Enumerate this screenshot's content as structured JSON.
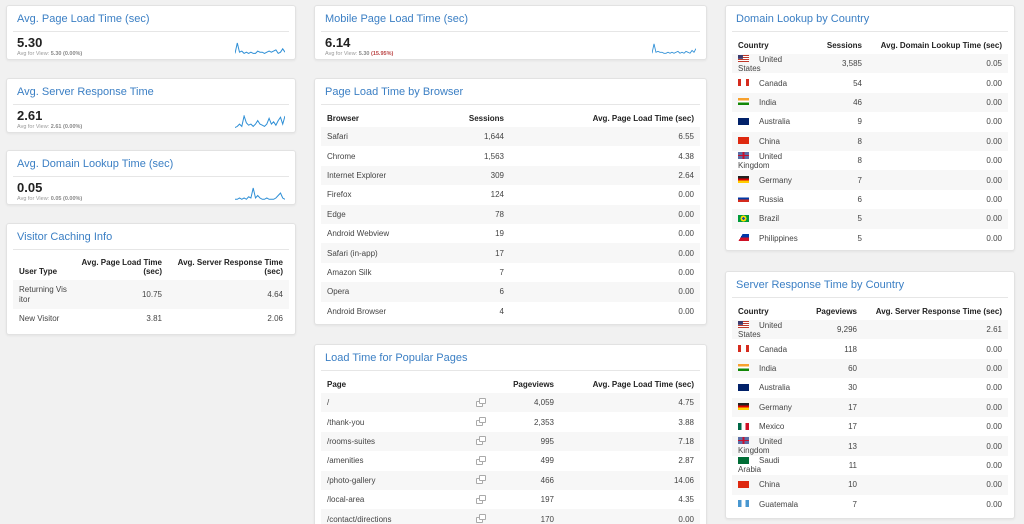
{
  "stat_cards": [
    {
      "title": "Avg. Page Load Time (sec)",
      "value": "5.30",
      "sub_label": "Avg for View:",
      "sub_value": "5.30",
      "sub_change": "(0.00%)",
      "sparkline": [
        4,
        13,
        5,
        6,
        4,
        5,
        4,
        5,
        4,
        4,
        6,
        5,
        5,
        4,
        5,
        6,
        5,
        6,
        7,
        4,
        5,
        8,
        5
      ]
    },
    {
      "title": "Avg. Server Response Time",
      "value": "2.61",
      "sub_label": "Avg for View:",
      "sub_value": "2.61",
      "sub_change": "(0.00%)",
      "sparkline": [
        3,
        4,
        6,
        4,
        13,
        7,
        5,
        6,
        4,
        6,
        9,
        6,
        5,
        4,
        6,
        11,
        6,
        8,
        5,
        9,
        12,
        6,
        13
      ]
    },
    {
      "title": "Avg. Domain Lookup Time (sec)",
      "value": "0.05",
      "sub_label": "Avg for View:",
      "sub_value": "0.05",
      "sub_change": "(0.00%)",
      "sparkline": [
        3,
        3,
        4,
        3,
        4,
        3,
        5,
        4,
        12,
        4,
        6,
        4,
        3,
        3,
        4,
        3,
        3,
        3,
        4,
        6,
        8,
        4,
        3
      ]
    },
    {
      "title": "Mobile Page Load Time (sec)",
      "value": "6.14",
      "sub_label": "Avg for View:",
      "sub_value": "5.30",
      "sub_change": "(15.95%)",
      "sparkline": [
        4,
        14,
        5,
        6,
        5,
        5,
        4,
        4,
        5,
        4,
        5,
        4,
        5,
        6,
        4,
        5,
        4,
        6,
        5,
        4,
        7,
        5,
        9
      ]
    }
  ],
  "visitor_caching": {
    "title": "Visitor Caching Info",
    "columns": [
      "User Type",
      "Avg. Page Load Time (sec)",
      "Avg. Server Response Time (sec)"
    ],
    "rows": [
      [
        "Returning Visitor",
        "10.75",
        "4.64"
      ],
      [
        "New Visitor",
        "3.81",
        "2.06"
      ]
    ]
  },
  "browser_table": {
    "title": "Page Load Time by Browser",
    "columns": [
      "Browser",
      "Sessions",
      "Avg. Page Load Time (sec)"
    ],
    "rows": [
      [
        "Safari",
        "1,644",
        "6.55"
      ],
      [
        "Chrome",
        "1,563",
        "4.38"
      ],
      [
        "Internet Explorer",
        "309",
        "2.64"
      ],
      [
        "Firefox",
        "124",
        "0.00"
      ],
      [
        "Edge",
        "78",
        "0.00"
      ],
      [
        "Android Webview",
        "19",
        "0.00"
      ],
      [
        "Safari (in-app)",
        "17",
        "0.00"
      ],
      [
        "Amazon Silk",
        "7",
        "0.00"
      ],
      [
        "Opera",
        "6",
        "0.00"
      ],
      [
        "Android Browser",
        "4",
        "0.00"
      ]
    ]
  },
  "pages_table": {
    "title": "Load Time for Popular Pages",
    "columns": [
      "Page",
      "Pageviews",
      "Avg. Page Load Time (sec)"
    ],
    "link_icon": "external-link-icon",
    "rows": [
      [
        "/",
        "4,059",
        "4.75"
      ],
      [
        "/thank-you",
        "2,353",
        "3.88"
      ],
      [
        "/rooms-suites",
        "995",
        "7.18"
      ],
      [
        "/amenities",
        "499",
        "2.87"
      ],
      [
        "/photo-gallery",
        "466",
        "14.06"
      ],
      [
        "/local-area",
        "197",
        "4.35"
      ],
      [
        "/contact/directions",
        "170",
        "0.00"
      ]
    ]
  },
  "domain_lookup_table": {
    "title": "Domain Lookup by Country",
    "columns": [
      "Country",
      "Sessions",
      "Avg. Domain Lookup Time (sec)"
    ],
    "rows": [
      {
        "flag": "us",
        "country": "United States",
        "count": "3,585",
        "time": "0.05"
      },
      {
        "flag": "ca",
        "country": "Canada",
        "count": "54",
        "time": "0.00"
      },
      {
        "flag": "in",
        "country": "India",
        "count": "46",
        "time": "0.00"
      },
      {
        "flag": "au",
        "country": "Australia",
        "count": "9",
        "time": "0.00"
      },
      {
        "flag": "cn",
        "country": "China",
        "count": "8",
        "time": "0.00"
      },
      {
        "flag": "gb",
        "country": "United Kingdom",
        "count": "8",
        "time": "0.00"
      },
      {
        "flag": "de",
        "country": "Germany",
        "count": "7",
        "time": "0.00"
      },
      {
        "flag": "ru",
        "country": "Russia",
        "count": "6",
        "time": "0.00"
      },
      {
        "flag": "br",
        "country": "Brazil",
        "count": "5",
        "time": "0.00"
      },
      {
        "flag": "ph",
        "country": "Philippines",
        "count": "5",
        "time": "0.00"
      }
    ]
  },
  "server_response_table": {
    "title": "Server Response Time by Country",
    "columns": [
      "Country",
      "Pageviews",
      "Avg. Server Response Time (sec)"
    ],
    "rows": [
      {
        "flag": "us",
        "country": "United States",
        "count": "9,296",
        "time": "2.61"
      },
      {
        "flag": "ca",
        "country": "Canada",
        "count": "118",
        "time": "0.00"
      },
      {
        "flag": "in",
        "country": "India",
        "count": "60",
        "time": "0.00"
      },
      {
        "flag": "au",
        "country": "Australia",
        "count": "30",
        "time": "0.00"
      },
      {
        "flag": "de",
        "country": "Germany",
        "count": "17",
        "time": "0.00"
      },
      {
        "flag": "mx",
        "country": "Mexico",
        "count": "17",
        "time": "0.00"
      },
      {
        "flag": "gb",
        "country": "United Kingdom",
        "count": "13",
        "time": "0.00"
      },
      {
        "flag": "sa",
        "country": "Saudi Arabia",
        "count": "11",
        "time": "0.00"
      },
      {
        "flag": "cn",
        "country": "China",
        "count": "10",
        "time": "0.00"
      },
      {
        "flag": "gt",
        "country": "Guatemala",
        "count": "7",
        "time": "0.00"
      }
    ]
  },
  "colors": {
    "title_blue": "#3b7fc4",
    "sparkline_blue": "#2e8fd6",
    "negative_red": "#b44444"
  }
}
